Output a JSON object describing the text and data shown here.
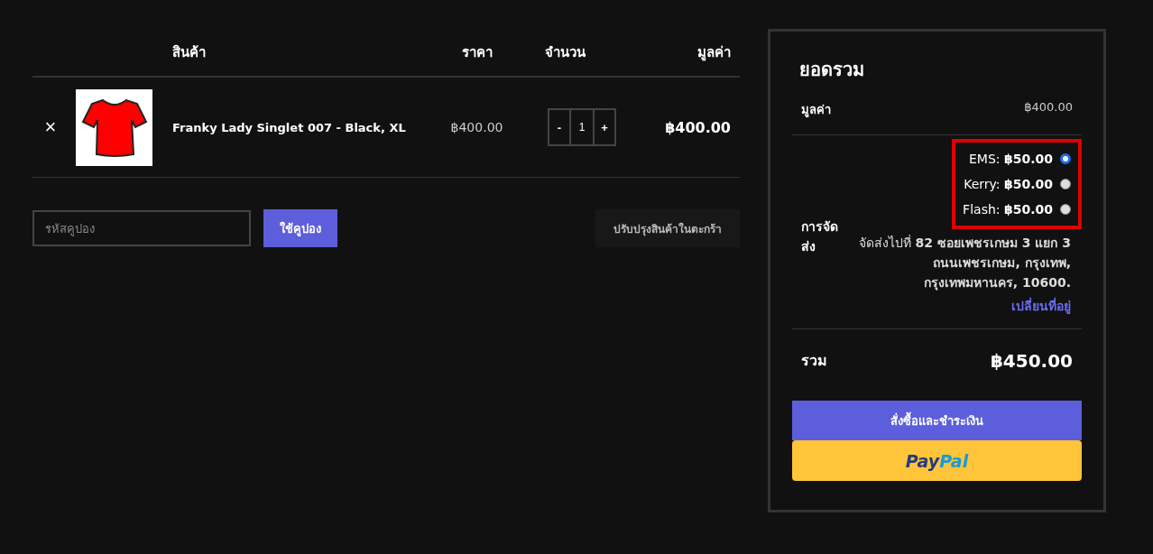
{
  "cart": {
    "columns": [
      "สินค้า",
      "ราคา",
      "จำนวน",
      "มูลค่า"
    ],
    "rows": [
      {
        "remove": "×",
        "product": "Franky Lady Singlet 007 - Black, XL",
        "price": "฿400.00",
        "quantity": {
          "minus": "-",
          "value": "1",
          "plus": "+"
        },
        "subtotal": "฿400.00"
      }
    ]
  },
  "coupon": {
    "placeholder": "รหัสคูปอง",
    "apply_button": "ใช้คูปอง",
    "update_button": "ปรับปรุงสินค้าในตะกร้า"
  },
  "totals": {
    "title": "ยอดรวม",
    "subtotal_label": "มูลค่า",
    "subtotal": "฿400.00",
    "shipping": {
      "label": "การจัดส่ง",
      "highlighted": true,
      "options": [
        {
          "name": "EMS:",
          "price": "฿50.00",
          "selected": true
        },
        {
          "name": "Kerry:",
          "price": "฿50.00",
          "selected": false
        },
        {
          "name": "Flash:",
          "price": "฿50.00",
          "selected": false
        }
      ],
      "address": "จัดส่งไปที่ **82 ซอยเพชรเกษม 3 แยก 3 ถนนเพชรเกษม, กรุงเทพ, กรุงเทพมหานคร, 10600.**",
      "change_link": "เปลี่ยนที่อยู่"
    },
    "total_label": "รวม",
    "total": "฿450.00",
    "checkout_button": "สั่งซื้อและชำระเงิน",
    "paypal_button": [
      "Pay",
      "Pal"
    ]
  }
}
